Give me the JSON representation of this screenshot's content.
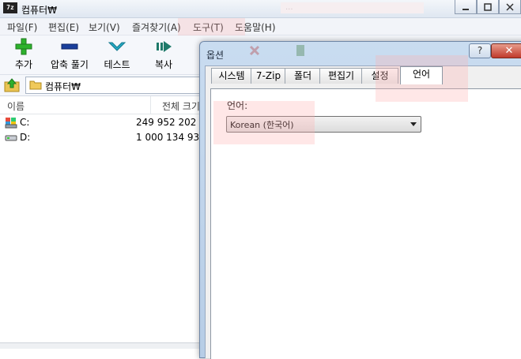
{
  "window": {
    "app_icon_text": "7z",
    "title": "컴퓨터₩",
    "background_tab_text": "..."
  },
  "menu": [
    "파일(F)",
    "편집(E)",
    "보기(V)",
    "즐겨찾기(A)",
    "도구(T)",
    "도움말(H)"
  ],
  "toolbar": {
    "add_label": "추가",
    "extract_label": "압축 풀기",
    "test_label": "테스트",
    "copy_label": "복사"
  },
  "address": {
    "path": "컴퓨터₩"
  },
  "file_list": {
    "col_name": "이름",
    "col_size": "전체 크기",
    "rows": [
      {
        "name": "C:",
        "size": "249 952 202 ..."
      },
      {
        "name": "D:",
        "size": "1 000 134 93..."
      }
    ]
  },
  "dialog": {
    "title": "옵션",
    "help_label": "?",
    "close_label": "✕",
    "tabs": [
      "시스템",
      "7-Zip",
      "폴더",
      "편집기",
      "설정",
      "언어"
    ],
    "active_tab": "언어",
    "language_label": "언어:",
    "language_value": "Korean (한국어)"
  },
  "colors": {
    "accent_green": "#2db22d",
    "accent_blue": "#1a3f9c",
    "accent_teal": "#25a9c4",
    "close_red": "#c0392b"
  }
}
